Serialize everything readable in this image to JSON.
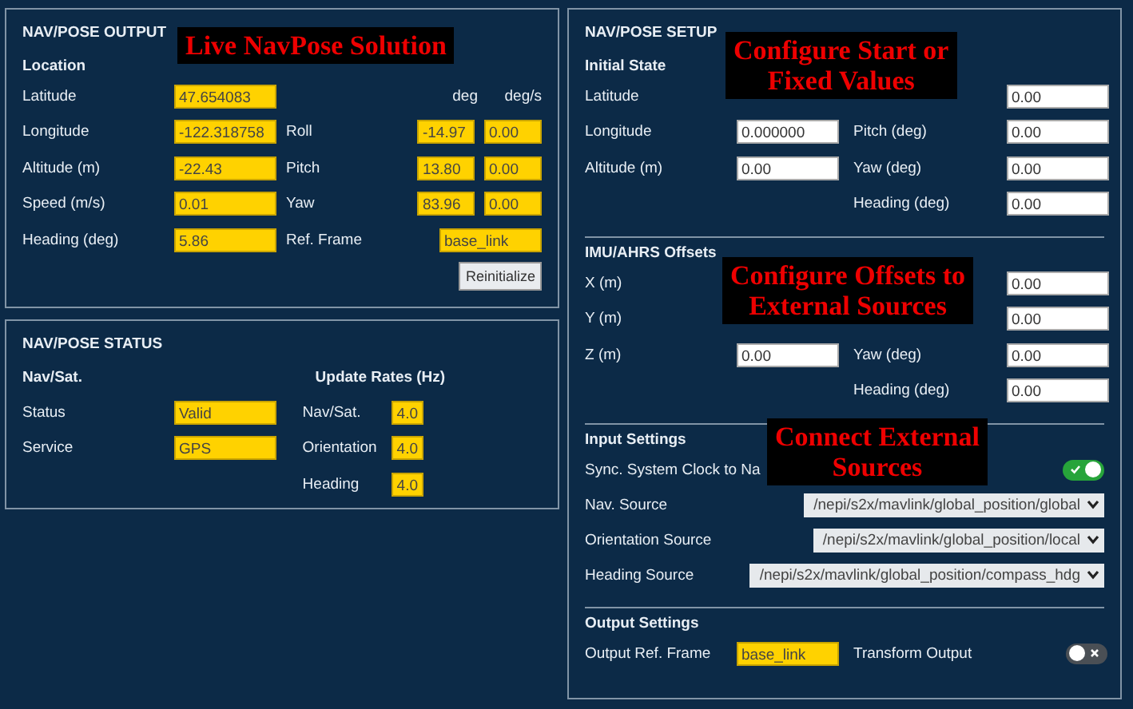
{
  "output": {
    "title": "NAV/POSE OUTPUT",
    "location_heading": "Location",
    "location": [
      {
        "label": "Latitude",
        "value": "47.654083"
      },
      {
        "label": "Longitude",
        "value": "-122.318758"
      },
      {
        "label": "Altitude (m)",
        "value": "-22.43"
      },
      {
        "label": "Speed (m/s)",
        "value": "0.01"
      },
      {
        "label": "Heading (deg)",
        "value": "5.86"
      }
    ],
    "orientation_columns": [
      "deg",
      "deg/s"
    ],
    "orientation": [
      {
        "label": "Roll",
        "deg": "-14.97",
        "rate": "0.00"
      },
      {
        "label": "Pitch",
        "deg": "13.80",
        "rate": "0.00"
      },
      {
        "label": "Yaw",
        "deg": "83.96",
        "rate": "0.00"
      }
    ],
    "ref_frame": {
      "label": "Ref. Frame",
      "value": "base_link"
    },
    "button": "Reinitialize"
  },
  "status": {
    "title": "NAV/POSE STATUS",
    "nav_heading": "Nav/Sat.",
    "nav": [
      {
        "label": "Status",
        "value": "Valid"
      },
      {
        "label": "Service",
        "value": "GPS"
      }
    ],
    "rates_heading": "Update Rates (Hz)",
    "rates": [
      {
        "label": "Nav/Sat.",
        "value": "4.0"
      },
      {
        "label": "Orientation",
        "value": "4.0"
      },
      {
        "label": "Heading",
        "value": "4.0"
      }
    ]
  },
  "setup": {
    "title": "NAV/POSE SETUP",
    "initial_heading": "Initial State",
    "initial": [
      {
        "left": {
          "label": "Latitude"
        },
        "right": {
          "value": "0.00"
        }
      },
      {
        "left": {
          "label": "Longitude",
          "value": "0.000000"
        },
        "right": {
          "label": "Pitch (deg)",
          "value": "0.00"
        }
      },
      {
        "left": {
          "label": "Altitude (m)",
          "value": "0.00"
        },
        "right": {
          "label": "Yaw (deg)",
          "value": "0.00"
        }
      },
      {
        "right": {
          "label": "Heading (deg)",
          "value": "0.00"
        }
      }
    ],
    "offsets_heading": "IMU/AHRS Offsets",
    "offsets": [
      {
        "left": {
          "label": "X (m)"
        },
        "right": {
          "value": "0.00"
        }
      },
      {
        "left": {
          "label": "Y (m)"
        },
        "right": {
          "value": "0.00"
        }
      },
      {
        "left": {
          "label": "Z (m)",
          "value": "0.00"
        },
        "right": {
          "label": "Yaw (deg)",
          "value": "0.00"
        }
      },
      {
        "right": {
          "label": "Heading (deg)",
          "value": "0.00"
        }
      }
    ],
    "input_heading": "Input Settings",
    "sync": {
      "label": "Sync. System Clock to Na",
      "on": true
    },
    "sources": [
      {
        "label": "Nav. Source",
        "value": "/nepi/s2x/mavlink/global_position/global"
      },
      {
        "label": "Orientation Source",
        "value": "/nepi/s2x/mavlink/global_position/local"
      },
      {
        "label": "Heading Source",
        "value": "/nepi/s2x/mavlink/global_position/compass_hdg"
      }
    ],
    "output_heading": "Output Settings",
    "output_frame": {
      "label": "Output Ref. Frame",
      "value": "base_link"
    },
    "transform": {
      "label": "Transform Output",
      "on": false
    }
  },
  "annotations": [
    {
      "lines": [
        "Live NavPose Solution"
      ]
    },
    {
      "lines": [
        "Configure Start or",
        "Fixed Values"
      ]
    },
    {
      "lines": [
        "Configure Offsets to",
        "External Sources"
      ]
    },
    {
      "lines": [
        "Connect External",
        "Sources"
      ]
    }
  ]
}
